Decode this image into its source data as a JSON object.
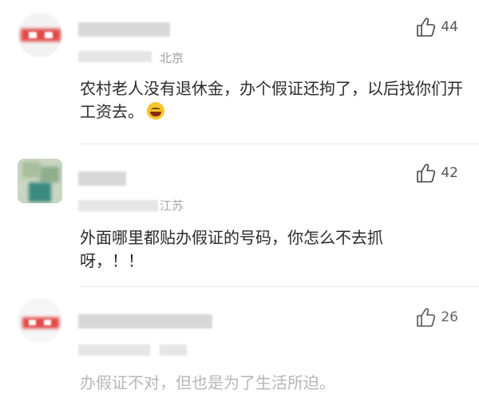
{
  "comments": [
    {
      "location": "北京",
      "text": "农村老人没有退休金，办个假证还拘了，以后找你们开工资去。",
      "likes": "44",
      "emoji": "crying-laughing-emoji"
    },
    {
      "location": "江苏",
      "text": "外面哪里都贴办假证的号码，你怎么不去抓呀，！！",
      "likes": "42"
    },
    {
      "location": "",
      "text": "办假证不对，但也是为了生活所迫。",
      "likes": "26"
    }
  ],
  "icons": {
    "like": "thumbs-up-icon"
  },
  "colors": {
    "text": "#2b2b2b",
    "muted": "#9e9e9e",
    "faded": "#b7b7b7",
    "divider": "#e6e6e6"
  }
}
